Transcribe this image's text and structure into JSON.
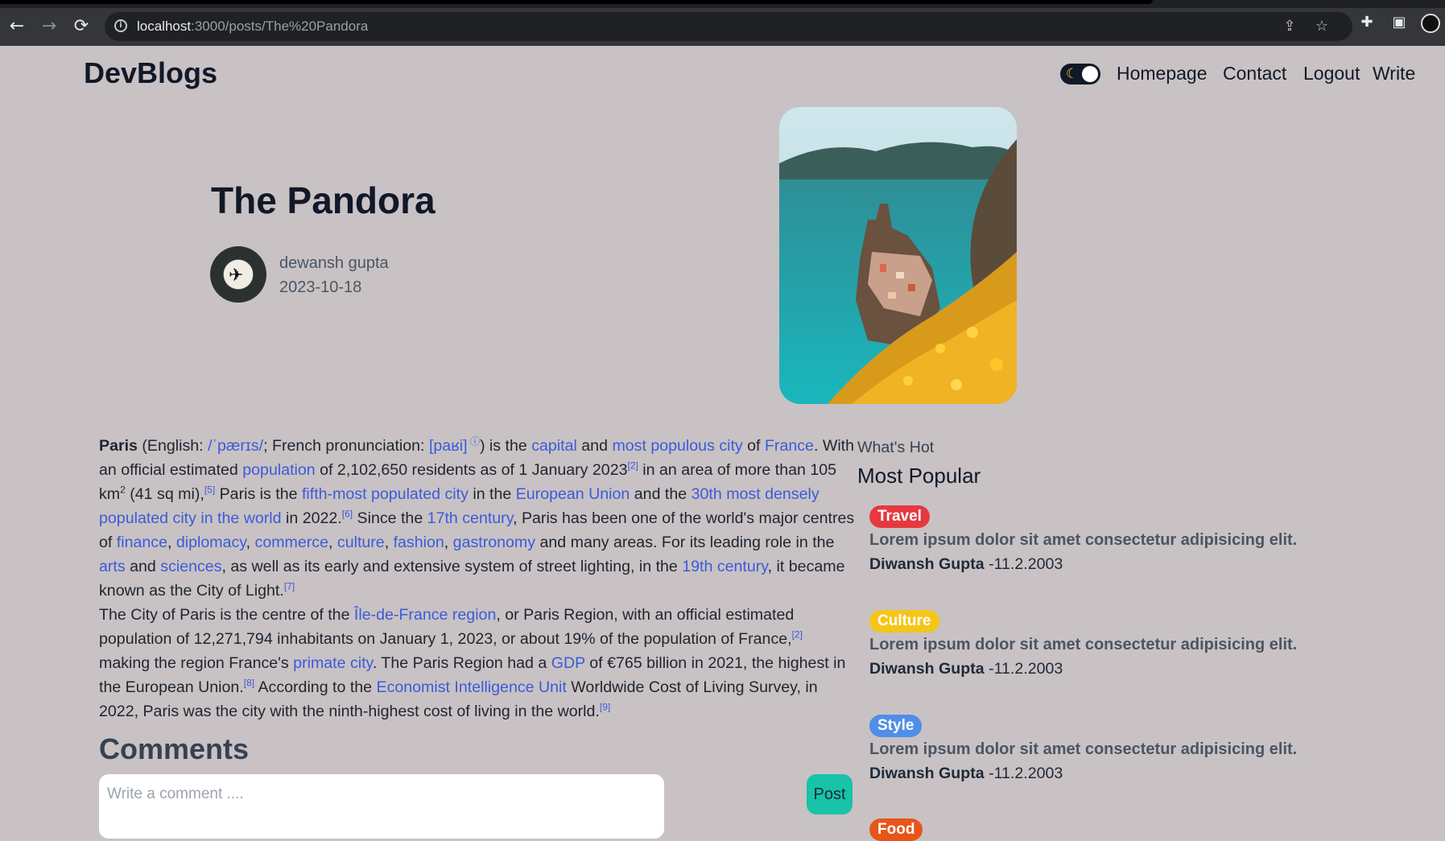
{
  "browser": {
    "url_host": "localhost",
    "url_rest": ":3000/posts/The%20Pandora"
  },
  "site": {
    "logo": "DevBlogs"
  },
  "nav": {
    "links": [
      "Homepage",
      "Contact",
      "Logout",
      "Write"
    ]
  },
  "post": {
    "title": "The Pandora",
    "author": "dewansh gupta",
    "date": "2023-10-18"
  },
  "article": {
    "p1": [
      {
        "t": "b",
        "v": "Paris"
      },
      {
        "t": "s",
        "v": " (English: "
      },
      {
        "t": "a",
        "v": "/ˈpærɪs/"
      },
      {
        "t": "s",
        "v": "; French pronunciation: "
      },
      {
        "t": "a",
        "v": "[paʁi]"
      },
      {
        "t": "sup",
        "v": " ⓘ"
      },
      {
        "t": "s",
        "v": ") is the "
      },
      {
        "t": "a",
        "v": "capital"
      },
      {
        "t": "s",
        "v": " and "
      },
      {
        "t": "a",
        "v": "most populous city"
      },
      {
        "t": "s",
        "v": " of "
      },
      {
        "t": "a",
        "v": "France"
      },
      {
        "t": "s",
        "v": ". With an official estimated "
      },
      {
        "t": "a",
        "v": "population"
      },
      {
        "t": "s",
        "v": " of 2,102,650 residents as of 1 January 2023"
      },
      {
        "t": "sup",
        "v": "[2]"
      },
      {
        "t": "s",
        "v": " in an area of more than 105 km"
      },
      {
        "t": "supb",
        "v": "2"
      },
      {
        "t": "s",
        "v": " (41 sq mi),"
      },
      {
        "t": "sup",
        "v": "[5]"
      },
      {
        "t": "s",
        "v": " Paris is the "
      },
      {
        "t": "a",
        "v": "fifth-most populated city"
      },
      {
        "t": "s",
        "v": " in the "
      },
      {
        "t": "a",
        "v": "European Union"
      },
      {
        "t": "s",
        "v": " and the "
      },
      {
        "t": "a",
        "v": "30th most densely populated city in the world"
      },
      {
        "t": "s",
        "v": " in 2022."
      },
      {
        "t": "sup",
        "v": "[6]"
      },
      {
        "t": "s",
        "v": " Since the "
      },
      {
        "t": "a",
        "v": "17th century"
      },
      {
        "t": "s",
        "v": ", Paris has been one of the world's major centres of "
      },
      {
        "t": "a",
        "v": "finance"
      },
      {
        "t": "s",
        "v": ", "
      },
      {
        "t": "a",
        "v": "diplomacy"
      },
      {
        "t": "s",
        "v": ", "
      },
      {
        "t": "a",
        "v": "commerce"
      },
      {
        "t": "s",
        "v": ", "
      },
      {
        "t": "a",
        "v": "culture"
      },
      {
        "t": "s",
        "v": ", "
      },
      {
        "t": "a",
        "v": "fashion"
      },
      {
        "t": "s",
        "v": ", "
      },
      {
        "t": "a",
        "v": "gastronomy"
      },
      {
        "t": "s",
        "v": " and many areas. For its leading role in the "
      },
      {
        "t": "a",
        "v": "arts"
      },
      {
        "t": "s",
        "v": " and "
      },
      {
        "t": "a",
        "v": "sciences"
      },
      {
        "t": "s",
        "v": ", as well as its early and extensive system of street lighting, in the "
      },
      {
        "t": "a",
        "v": "19th century"
      },
      {
        "t": "s",
        "v": ", it became known as the City of Light."
      },
      {
        "t": "sup",
        "v": "[7]"
      }
    ],
    "p2": [
      {
        "t": "s",
        "v": "The City of Paris is the centre of the "
      },
      {
        "t": "a",
        "v": "Île-de-France region"
      },
      {
        "t": "s",
        "v": ", or Paris Region, with an official estimated population of 12,271,794 inhabitants on January 1, 2023, or about 19% of the population of France,"
      },
      {
        "t": "sup",
        "v": "[2]"
      },
      {
        "t": "s",
        "v": " making the region France's "
      },
      {
        "t": "a",
        "v": "primate city"
      },
      {
        "t": "s",
        "v": ". The Paris Region had a "
      },
      {
        "t": "a",
        "v": "GDP"
      },
      {
        "t": "s",
        "v": " of €765 billion in 2021, the highest in the European Union."
      },
      {
        "t": "sup",
        "v": "[8]"
      },
      {
        "t": "s",
        "v": " According to the "
      },
      {
        "t": "a",
        "v": "Economist Intelligence Unit"
      },
      {
        "t": "s",
        "v": " Worldwide Cost of Living Survey, in 2022, Paris was the city with the ninth-highest cost of living in the world."
      },
      {
        "t": "sup",
        "v": "[9]"
      }
    ]
  },
  "comments": {
    "heading": "Comments",
    "placeholder": "Write a comment ....",
    "post_label": "Post"
  },
  "sidebar": {
    "subtitle": "What's Hot",
    "title": "Most Popular",
    "items": [
      {
        "category": "Travel",
        "color": "#e5393f",
        "desc": "Lorem ipsum dolor sit amet consectetur adipisicing elit.",
        "author": "Diwansh Gupta",
        "date": " -11.2.2003"
      },
      {
        "category": "Culture",
        "color": "#f5c518",
        "desc": "Lorem ipsum dolor sit amet consectetur adipisicing elit.",
        "author": "Diwansh Gupta",
        "date": " -11.2.2003"
      },
      {
        "category": "Style",
        "color": "#4f8ee8",
        "desc": "Lorem ipsum dolor sit amet consectetur adipisicing elit.",
        "author": "Diwansh Gupta",
        "date": " -11.2.2003"
      },
      {
        "category": "Food",
        "color": "#e8551a",
        "desc": "",
        "author": "",
        "date": ""
      }
    ]
  }
}
